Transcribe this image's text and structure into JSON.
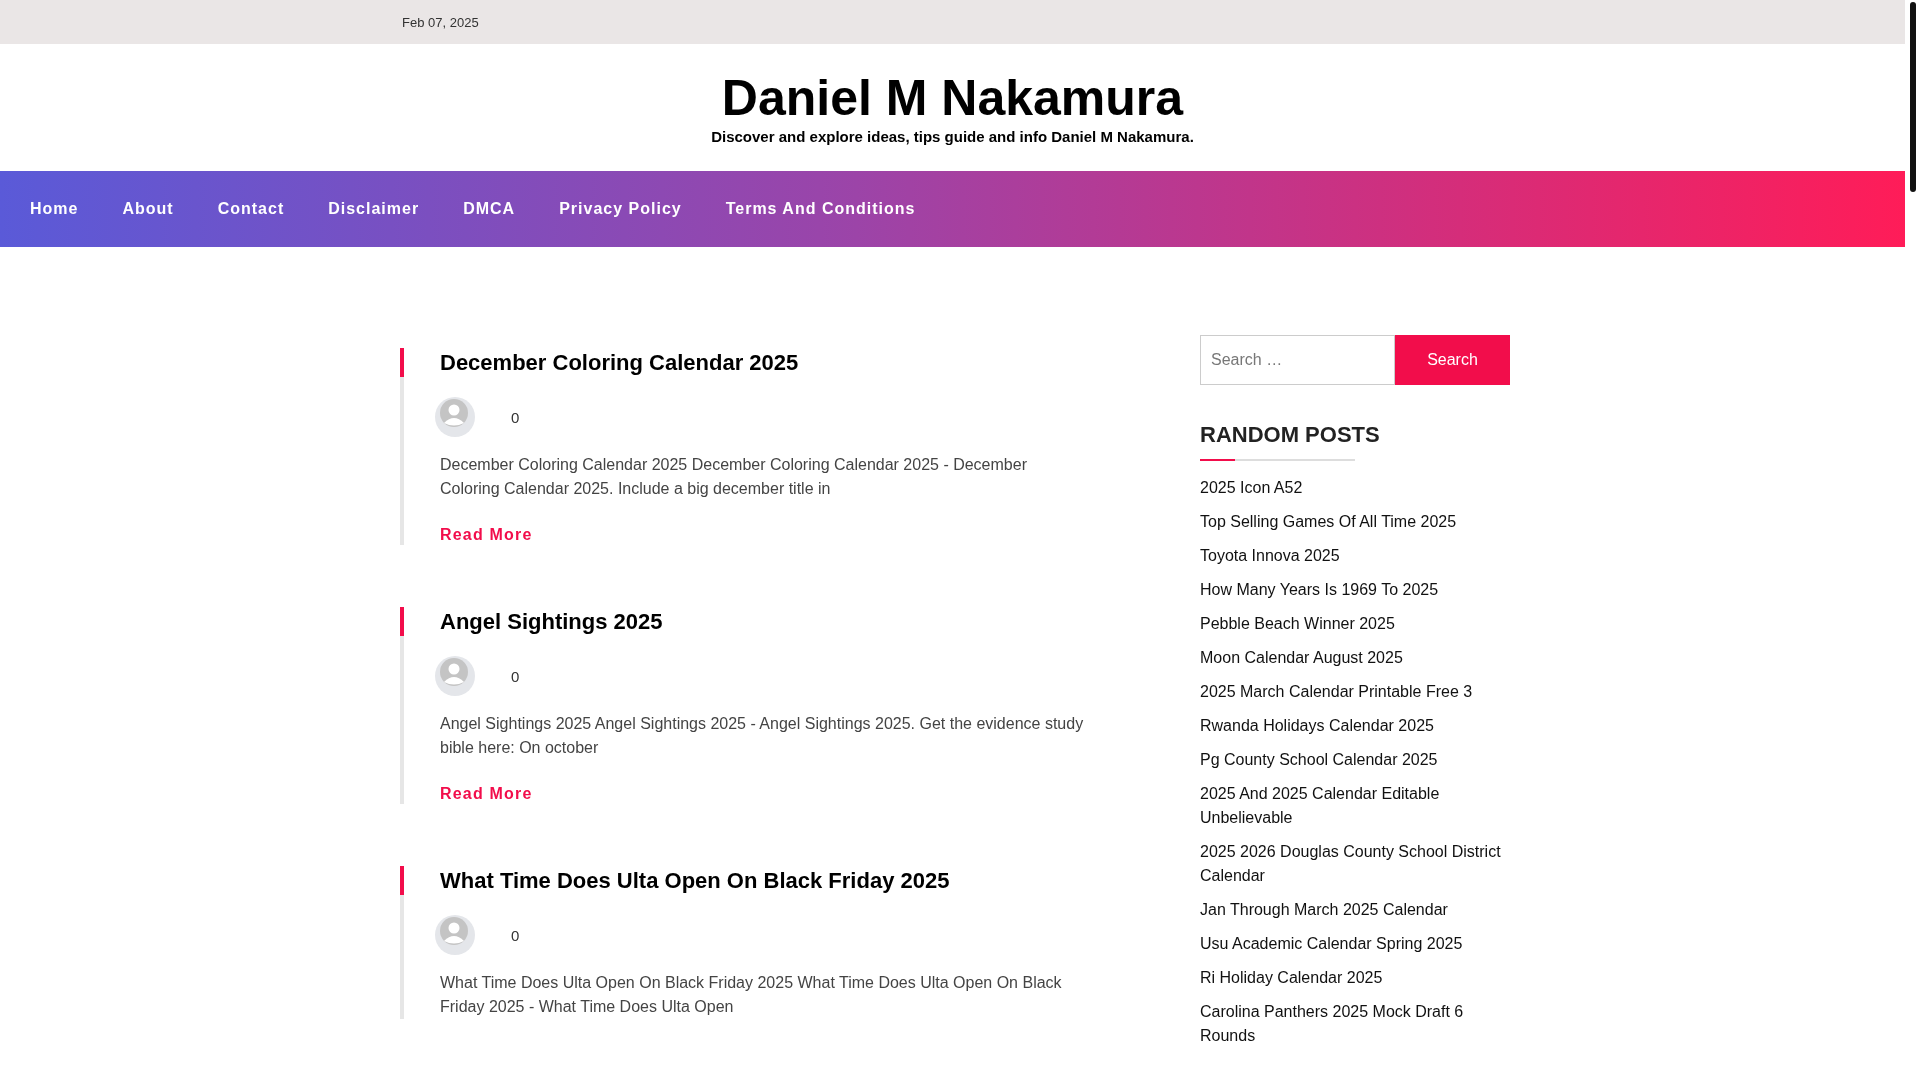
{
  "top_bar": {
    "date": "Feb 07, 2025"
  },
  "header": {
    "title": "Daniel M Nakamura",
    "tagline": "Discover and explore ideas, tips guide and info Daniel M Nakamura."
  },
  "nav": {
    "items": [
      "Home",
      "About",
      "Contact",
      "Disclaimer",
      "DMCA",
      "Privacy Policy",
      "Terms And Conditions"
    ]
  },
  "posts": [
    {
      "title": "December Coloring Calendar 2025",
      "comments": "0",
      "excerpt": "December Coloring Calendar 2025 December Coloring Calendar 2025 - December Coloring Calendar 2025. Include a big december title in",
      "read_more": "Read More"
    },
    {
      "title": "Angel Sightings 2025",
      "comments": "0",
      "excerpt": "Angel Sightings 2025 Angel Sightings 2025 - Angel Sightings 2025. Get the evidence study bible here: On october",
      "read_more": "Read More"
    },
    {
      "title": "What Time Does Ulta Open On Black Friday 2025",
      "comments": "0",
      "excerpt": "What Time Does Ulta Open On Black Friday 2025 What Time Does Ulta Open On Black Friday 2025 - What Time Does Ulta Open"
    }
  ],
  "sidebar": {
    "search": {
      "placeholder": "Search …",
      "button": "Search"
    },
    "random_posts": {
      "heading": "RANDOM POSTS",
      "items": [
        "2025 Icon A52",
        "Top Selling Games Of All Time 2025",
        "Toyota Innova 2025",
        "How Many Years Is 1969 To 2025",
        "Pebble Beach Winner 2025",
        "Moon Calendar August 2025",
        "2025 March Calendar Printable Free 3",
        "Rwanda Holidays Calendar 2025",
        "Pg County School Calendar 2025",
        "2025 And 2025 Calendar Editable Unbelievable",
        "2025 2026 Douglas County School District Calendar",
        "Jan Through March 2025 Calendar",
        "Usu Academic Calendar Spring 2025",
        "Ri Holiday Calendar 2025",
        "Carolina Panthers 2025 Mock Draft 6 Rounds"
      ]
    }
  }
}
